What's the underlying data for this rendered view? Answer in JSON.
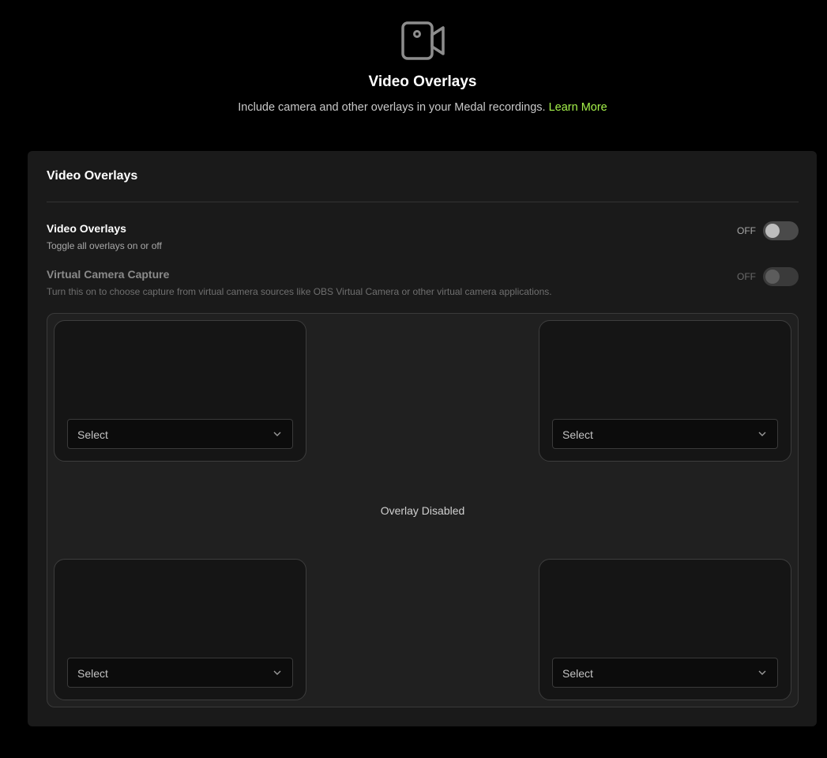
{
  "header": {
    "icon": "video-camera-icon",
    "title": "Video Overlays",
    "subtitle": "Include camera and other overlays in your Medal recordings.",
    "learn_more": "Learn More",
    "accent_color": "#a4f04a"
  },
  "panel": {
    "title": "Video Overlays",
    "settings": [
      {
        "title": "Video Overlays",
        "description": "Toggle all overlays on or off",
        "state_label": "OFF",
        "enabled": false
      },
      {
        "title": "Virtual Camera Capture",
        "description": "Turn this on to choose capture from virtual camera sources like OBS Virtual Camera or other virtual camera applications.",
        "state_label": "OFF",
        "enabled": false
      }
    ],
    "overlay_status": "Overlay Disabled",
    "slots": [
      {
        "position": "top-left",
        "select_value": "Select"
      },
      {
        "position": "top-right",
        "select_value": "Select"
      },
      {
        "position": "bottom-left",
        "select_value": "Select"
      },
      {
        "position": "bottom-right",
        "select_value": "Select"
      }
    ]
  }
}
